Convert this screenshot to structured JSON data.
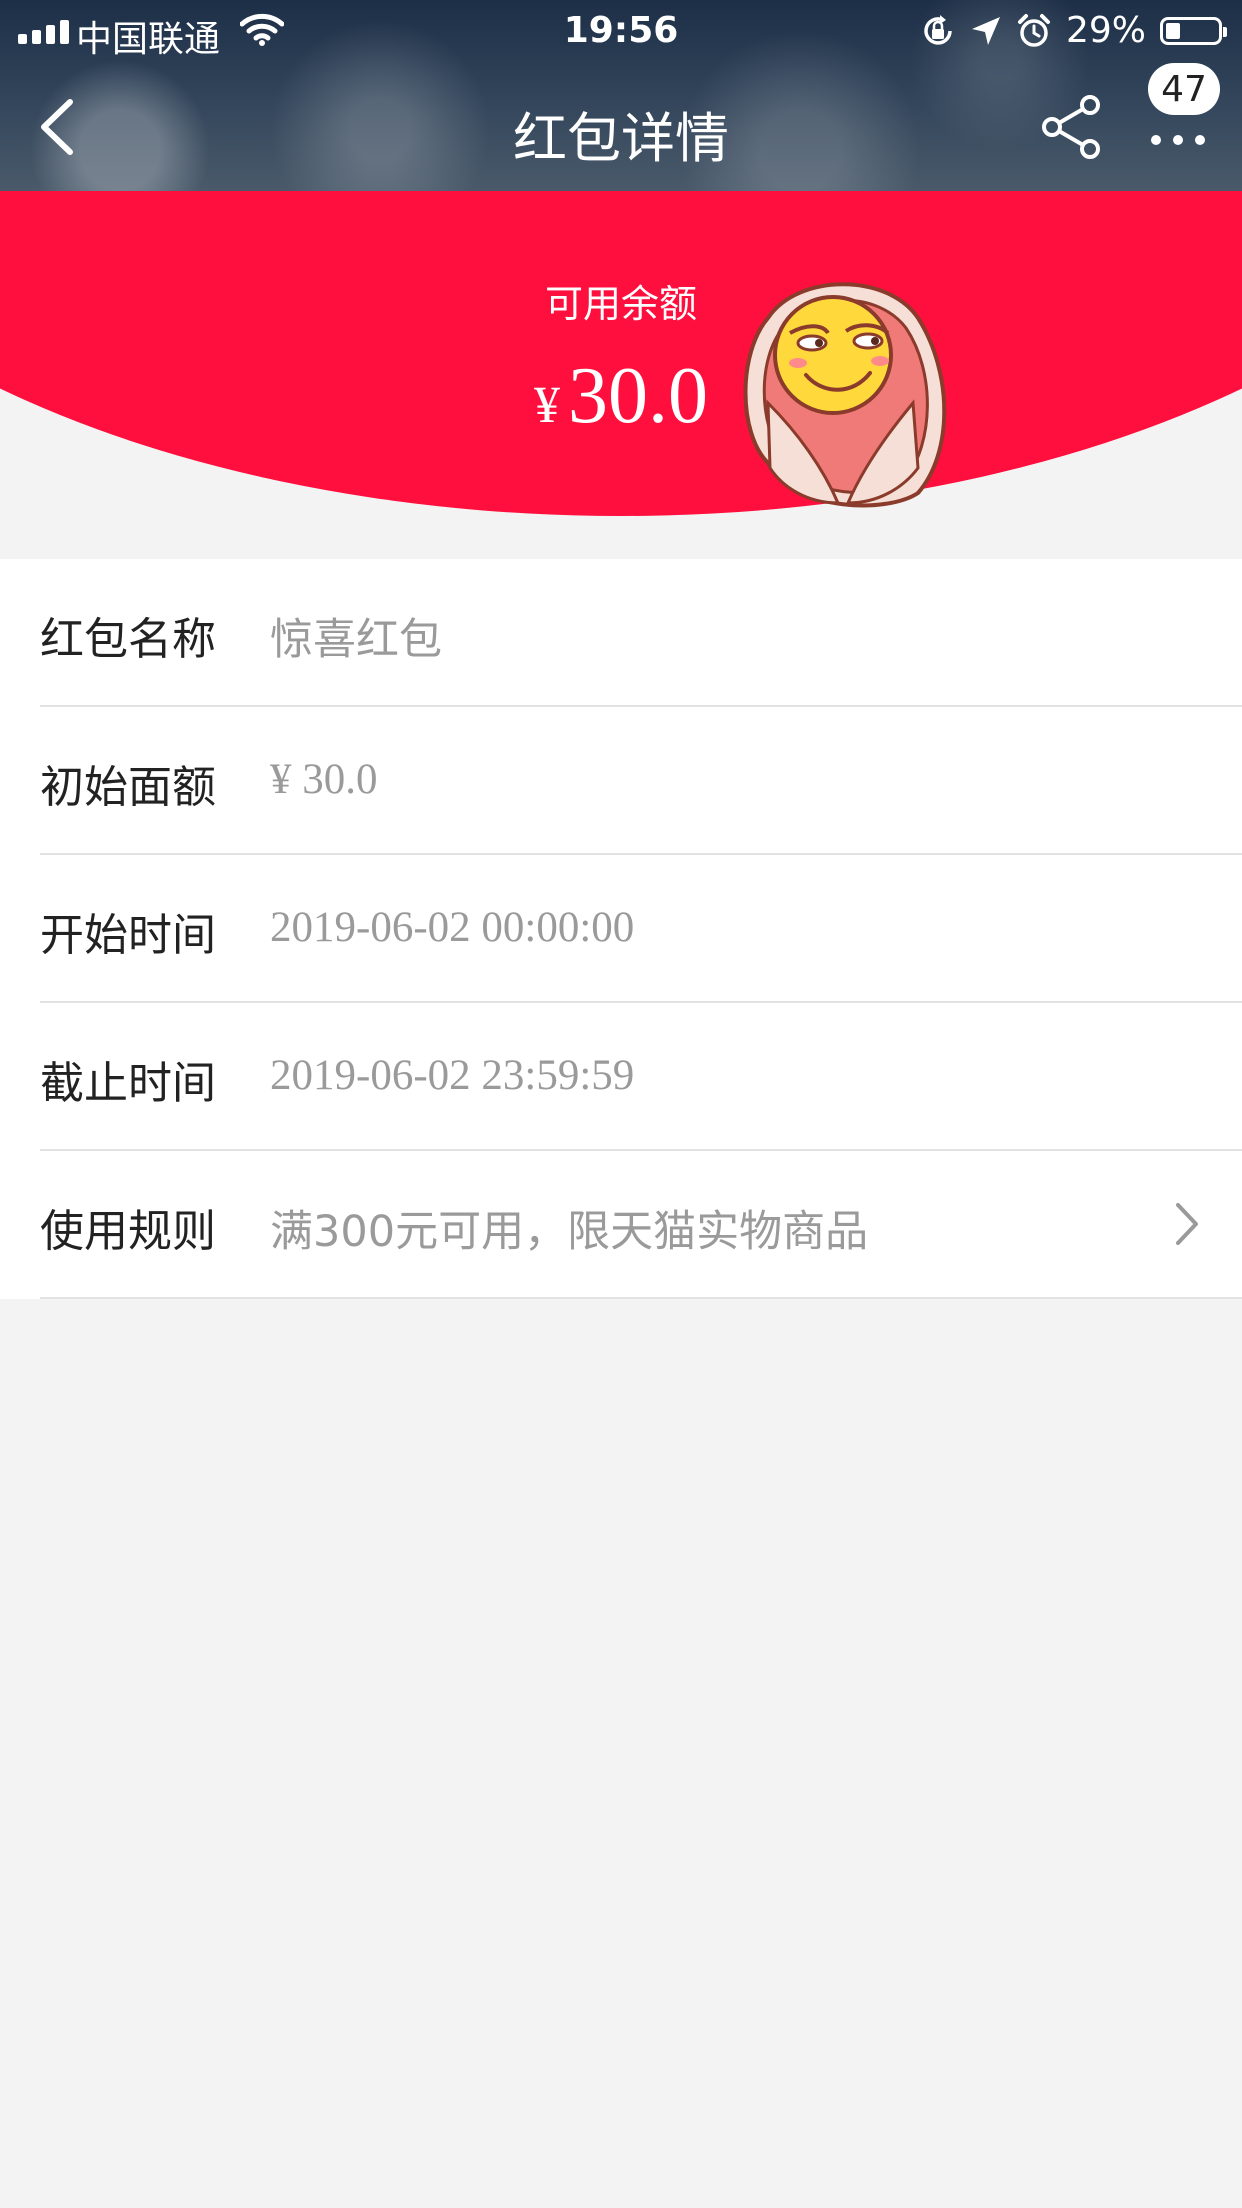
{
  "status_bar": {
    "carrier": "中国联通",
    "time": "19:56",
    "battery_percent": "29%",
    "icons": [
      "signal-icon",
      "wifi-icon",
      "orientation-lock-icon",
      "location-arrow-icon",
      "alarm-icon",
      "battery-icon"
    ]
  },
  "nav": {
    "title": "红包详情",
    "badge_count": "47",
    "icons": [
      "back-icon",
      "share-icon",
      "more-icon"
    ]
  },
  "balance": {
    "label": "可用余额",
    "currency": "¥",
    "amount": "30.0"
  },
  "details": [
    {
      "label": "红包名称",
      "value": "惊喜红包"
    },
    {
      "label": "初始面额",
      "value": "¥ 30.0"
    },
    {
      "label": "开始时间",
      "value": "2019-06-02 00:00:00"
    },
    {
      "label": "截止时间",
      "value": "2019-06-02 23:59:59"
    },
    {
      "label": "使用规则",
      "value": "满300元可用，限天猫实物商品"
    }
  ],
  "colors": {
    "banner_red": "#ff0f3e",
    "header_dark": "#1d2f47",
    "label_text": "#222222",
    "value_text": "#9a9a9a"
  }
}
